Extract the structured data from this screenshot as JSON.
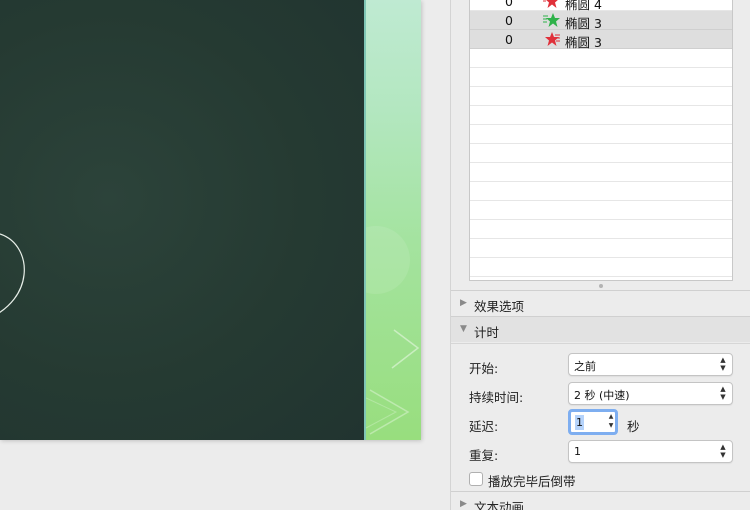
{
  "animation_list": {
    "rows": [
      {
        "order": "0",
        "icon": "red-exit-star-icon",
        "name": "椭圆 4",
        "selected": false
      },
      {
        "order": "0",
        "icon": "green-entrance-star-icon",
        "name": "椭圆 3",
        "selected": true
      },
      {
        "order": "0",
        "icon": "red-exit-star-icon",
        "name": "椭圆 3",
        "selected": true
      }
    ]
  },
  "sections": {
    "effect_options": "效果选项",
    "timing": "计时",
    "text_animation": "文本动画"
  },
  "timing": {
    "start_label": "开始:",
    "start_value": "之前",
    "duration_label": "持续时间:",
    "duration_value": "2 秒 (中速)",
    "delay_label": "延迟:",
    "delay_value": "1",
    "delay_unit": "秒",
    "repeat_label": "重复:",
    "repeat_value": "1",
    "rewind_label": "播放完毕后倒带",
    "rewind_checked": false
  },
  "colors": {
    "slide_background": "#263b33",
    "strip_gradient_top": "#bfead2",
    "strip_gradient_bottom": "#98de7e",
    "exit_star": "#e0303a",
    "entrance_star": "#2fb24a",
    "focus_ring": "#7eaef0"
  }
}
